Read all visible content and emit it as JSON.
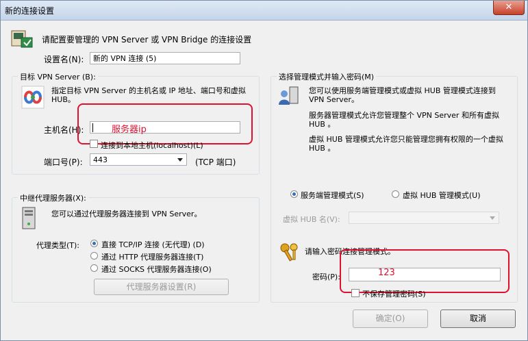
{
  "window": {
    "title": "新的连接设置",
    "close_label": "✕"
  },
  "header": {
    "description": "请配置要管理的 VPN Server 或 VPN Bridge 的连接设置"
  },
  "setting_name": {
    "label": "设置名(N):",
    "value": "新的 VPN 连接 (5)"
  },
  "target_group": {
    "title": "目标 VPN Server (B):",
    "description": "指定目标 VPN Server 的主机名或 IP 地址、端口号和虚拟 HUB。",
    "host_label": "主机名(H):",
    "host_value": "",
    "host_annotation": "服务器ip",
    "localhost_label": "连接到本地主机(localhost)(L)",
    "port_label": "端口号(P):",
    "port_value": "443",
    "port_suffix": "(TCP 端口)"
  },
  "proxy_group": {
    "title": "中继代理服务器(X):",
    "description": "您可以通过代理服务器连接到 VPN Server。",
    "type_label": "代理类型(T):",
    "options": [
      "直接 TCP/IP 连接 (无代理) (D)",
      "通过 HTTP 代理服务器连接(T)",
      "通过 SOCKS 代理服务器连接(O)"
    ],
    "settings_button": "代理服务器设置(R)"
  },
  "admin_group": {
    "title": "选择管理模式并输入密码(M)",
    "desc1": "您可以使用服务端管理模式或虚拟 HUB 管理模式连接到 VPN Server。",
    "desc2": "服务器管理模式允许您管理整个 VPN Server 和所有虚拟 HUB 。",
    "desc3": "虚拟 HUB 管理模式允许您只能管理您拥有权限的一个虚拟 HUB 。",
    "mode_server": "服务端管理模式(S)",
    "mode_hub": "虚拟 HUB 管理模式(U)",
    "hub_name_label": "虚拟 HUB 名(V):",
    "hub_name_value": "",
    "password_prompt": "请输入密码连接管理模式。",
    "password_label": "密码(P):",
    "password_annotation": "123",
    "no_save_label": "不保存管理密码(S)"
  },
  "buttons": {
    "ok": "确定(O)",
    "cancel": "取消"
  },
  "colors": {
    "annotation_red": "#e0102e",
    "titlebar": "#c4d5ea"
  },
  "icons": [
    "settings-computer-icon",
    "vpn-logo-icon",
    "server-tower-icon",
    "admin-users-icon",
    "keys-icon",
    "close-icon",
    "dropdown-arrow-icon"
  ]
}
